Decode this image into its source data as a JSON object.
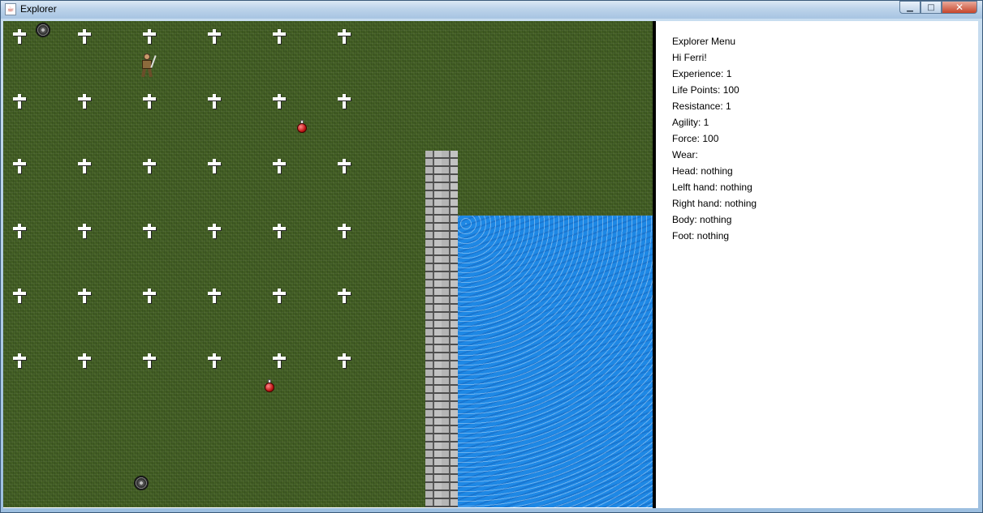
{
  "window": {
    "title": "Explorer",
    "icon": "java-cup-icon",
    "controls": {
      "minimize": "▁",
      "maximize": "□",
      "close": "✕"
    }
  },
  "colors": {
    "grass": "#3f5a22",
    "water": "#1e88e5",
    "wall": "#8a8a8a",
    "divider": "#000000",
    "panel": "#ffffff"
  },
  "map": {
    "graves": {
      "count": 36,
      "icon": "grave-cross-icon"
    },
    "potions": {
      "count": 2,
      "icon": "red-potion-icon"
    },
    "shields": {
      "count": 2,
      "icon": "round-shield-icon"
    },
    "player": {
      "icon": "warrior-icon"
    },
    "terrain": [
      "grass",
      "stone-wall",
      "water"
    ]
  },
  "menu": {
    "title": "Explorer Menu",
    "greeting": "Hi Ferri!",
    "experience": "Experience: 1",
    "life_points": "Life Points: 100",
    "resistance": "Resistance: 1",
    "agility": "Agility: 1",
    "force": "Force: 100",
    "wear": "Wear:",
    "head": "Head: nothing",
    "left_hand": "Lelft hand: nothing",
    "right_hand": "Right hand: nothing",
    "body": "Body: nothing",
    "foot": "Foot: nothing"
  }
}
